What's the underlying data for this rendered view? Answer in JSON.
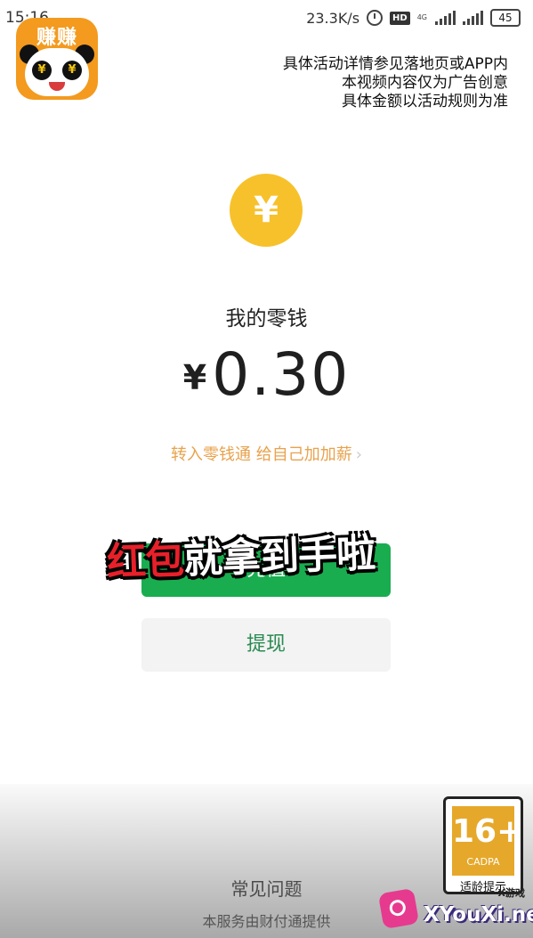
{
  "status_bar": {
    "time": "15:16",
    "net_speed": "23.3K/s",
    "hd": "HD",
    "net_type": "4G",
    "battery": "45"
  },
  "app_logo": {
    "text": "赚赚"
  },
  "disclaimer": {
    "line1": "具体活动详情参见落地页或APP内",
    "line2": "本视频内容仅为广告创意",
    "line3": "具体金额以活动规则为准"
  },
  "wallet": {
    "coin_glyph": "¥",
    "title": "我的零钱",
    "currency": "¥",
    "amount": "0.30",
    "promo": "转入零钱通 给自己加加薪",
    "promo_chevron": "›"
  },
  "buttons": {
    "recharge": "充值",
    "withdraw": "提现"
  },
  "caption": {
    "red_part": "红包",
    "white_part": "就拿到手啦"
  },
  "footer": {
    "faq": "常见问题",
    "note": "本服务由财付通提供"
  },
  "age_badge": {
    "number": "16+",
    "org": "CADPA",
    "label": "适龄提示"
  },
  "watermark": {
    "small": "X游戏",
    "text": "XYouXi.net"
  },
  "colors": {
    "accent_green": "#19ad4f",
    "coin_yellow": "#f7c12b",
    "promo_orange": "#e8a24d"
  }
}
